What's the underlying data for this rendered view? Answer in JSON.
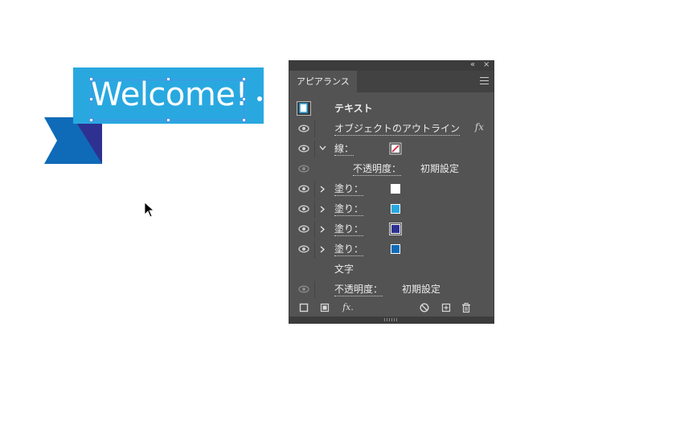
{
  "artwork": {
    "welcome_text": "Welcome!",
    "colors": {
      "banner": "#29a8e0",
      "ribbon_light": "#0f6bb8",
      "ribbon_dark": "#2e3192",
      "selection": "#4a90e2"
    }
  },
  "panel": {
    "title": "アピアランス",
    "topbar": {
      "collapse_icon": "«",
      "close_icon": "×"
    },
    "header_label": "テキスト",
    "rows": [
      {
        "label": "オブジェクトのアウトライン",
        "fx": "fx"
      },
      {
        "label": "線：",
        "expanded": true,
        "swatch": "none-red-slash"
      },
      {
        "label": "不透明度：",
        "value": "初期設定"
      },
      {
        "label": "塗り：",
        "swatch": "#ffffff"
      },
      {
        "label": "塗り：",
        "swatch": "#29a8e0"
      },
      {
        "label": "塗り：",
        "swatch": "#2e3192"
      },
      {
        "label": "塗り：",
        "swatch": "#0f6bb8"
      }
    ],
    "section_characters": "文字",
    "bottom_opacity": {
      "label": "不透明度：",
      "value": "初期設定"
    },
    "bottom_fx": "fx."
  }
}
